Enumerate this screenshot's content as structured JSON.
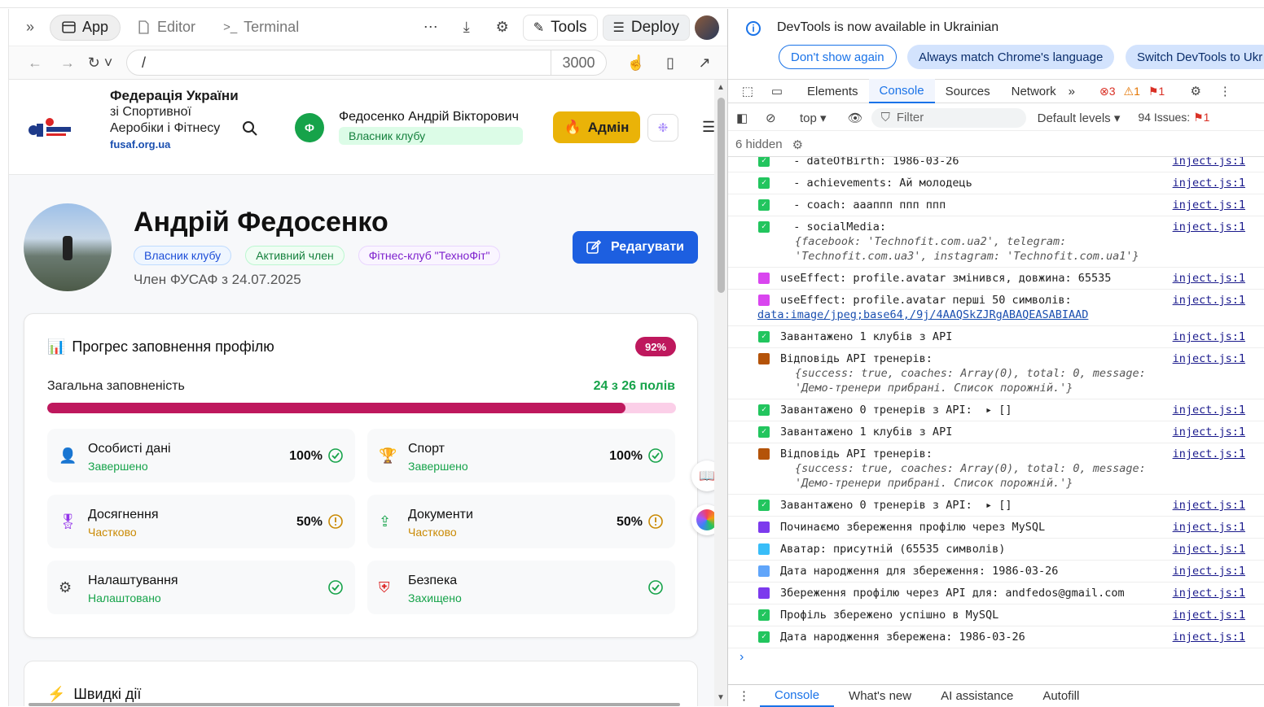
{
  "browser": {
    "tabs": [
      {
        "label": "App",
        "icon": "app-icon"
      },
      {
        "label": "Editor",
        "icon": "file-icon"
      },
      {
        "label": "Terminal",
        "icon": "terminal-icon"
      }
    ],
    "tools_label": "Tools",
    "deploy_label": "Deploy",
    "url_path": "/",
    "port": "3000"
  },
  "site": {
    "org_bold": "Федерація України",
    "org_rest": "зі Спортивної Аеробіки і Фітнесу",
    "org_url": "fusaf.org.ua",
    "user_initial": "Ф",
    "user_name": "Федосенко Андрій Вікторович",
    "user_role": "Власник клубу",
    "admin_label": "Адмін",
    "profile_name": "Андрій Федосенко",
    "badges": [
      "Власник клубу",
      "Активний член",
      "Фітнес-клуб \"ТехноФіт\""
    ],
    "member_since": "Член ФУСАФ з 24.07.2025",
    "edit_label": "Редагувати",
    "progress": {
      "title": "Прогрес заповнення профілю",
      "percent_label": "92%",
      "percent": 0.92,
      "overall_label": "Загальна заповненість",
      "overall_count": "24 з 26 полів",
      "sections": [
        {
          "title": "Особисті дані",
          "status": "Завершено",
          "pct": "100%",
          "state": "done",
          "icon": "user-icon"
        },
        {
          "title": "Спорт",
          "status": "Завершено",
          "pct": "100%",
          "state": "done",
          "icon": "trophy-icon"
        },
        {
          "title": "Досягнення",
          "status": "Частково",
          "pct": "50%",
          "state": "partial",
          "icon": "award-icon"
        },
        {
          "title": "Документи",
          "status": "Частково",
          "pct": "50%",
          "state": "partial",
          "icon": "upload-icon"
        },
        {
          "title": "Налаштування",
          "status": "Налаштовано",
          "pct": "",
          "state": "done",
          "icon": "gear-icon"
        },
        {
          "title": "Безпека",
          "status": "Захищено",
          "pct": "",
          "state": "done",
          "icon": "shield-icon"
        }
      ]
    },
    "quick_actions_title": "Швидкі дії"
  },
  "devtools": {
    "info_text": "DevTools is now available in Ukrainian",
    "btn_dont_show": "Don't show again",
    "btn_always_match": "Always match Chrome's language",
    "btn_switch": "Switch DevTools to Ukr",
    "tabs": [
      "Elements",
      "Console",
      "Sources",
      "Network"
    ],
    "errors": "3",
    "warnings": "1",
    "issues_badge": "1",
    "context": "top",
    "filter_placeholder": "Filter",
    "levels": "Default levels",
    "issues_label": "94 Issues:",
    "issues_count": "1",
    "hidden": "6 hidden",
    "logs": [
      {
        "icon": "chk",
        "text": "  - dateOfBirth: 1986-03-26",
        "src": "inject.js:1"
      },
      {
        "icon": "chk",
        "text": "  - achievements: Ай молодець",
        "src": "inject.js:1"
      },
      {
        "icon": "chk",
        "text": "  - coach: аааппп ппп ппп",
        "src": "inject.js:1"
      },
      {
        "icon": "chk",
        "text": "  - socialMedia:",
        "src": "inject.js:1",
        "obj": "{facebook: 'Technofit.com.ua2', telegram: 'Technofit.com.ua3', instagram: 'Technofit.com.ua1'}"
      },
      {
        "icon": "emo",
        "text": "useEffect: profile.avatar змінився, довжина: 65535",
        "src": "inject.js:1"
      },
      {
        "icon": "emo",
        "text": "useEffect: profile.avatar перші 50 символів:",
        "src": "inject.js:1",
        "link": "data:image/jpeg;base64,/9j/4AAQSkZJRgABAQEASABIAAD"
      },
      {
        "icon": "chk",
        "text": "Завантажено 1 клубів з API",
        "src": "inject.js:1"
      },
      {
        "icon": "brk",
        "text": "Відповідь API тренерів:",
        "src": "inject.js:1",
        "obj": "{success: true, coaches: Array(0), total: 0, message: 'Демо-тренери прибрані. Список порожній.'}"
      },
      {
        "icon": "chk",
        "text": "Завантажено 0 тренерів з API:  ▸ []",
        "src": "inject.js:1"
      },
      {
        "icon": "chk",
        "text": "Завантажено 1 клубів з API",
        "src": "inject.js:1"
      },
      {
        "icon": "brk",
        "text": "Відповідь API тренерів:",
        "src": "inject.js:1",
        "obj": "{success: true, coaches: Array(0), total: 0, message: 'Демо-тренери прибрані. Список порожній.'}"
      },
      {
        "icon": "chk",
        "text": "Завантажено 0 тренерів з API:  ▸ []",
        "src": "inject.js:1"
      },
      {
        "icon": "sav",
        "text": "Починаємо збереження профілю через MySQL",
        "src": "inject.js:1"
      },
      {
        "icon": "img",
        "text": "Аватар: присутній (65535 символів)",
        "src": "inject.js:1"
      },
      {
        "icon": "cal",
        "text": "Дата народження для збереження: 1986-03-26",
        "src": "inject.js:1"
      },
      {
        "icon": "sav",
        "text": "Збереження профілю через API для: andfedos@gmail.com",
        "src": "inject.js:1"
      },
      {
        "icon": "chk",
        "text": "Профіль збережено успішно в MySQL",
        "src": "inject.js:1"
      },
      {
        "icon": "chk",
        "text": "Дата народження збережена: 1986-03-26",
        "src": "inject.js:1"
      }
    ],
    "drawer_tabs": [
      "Console",
      "What's new",
      "AI assistance",
      "Autofill"
    ]
  }
}
